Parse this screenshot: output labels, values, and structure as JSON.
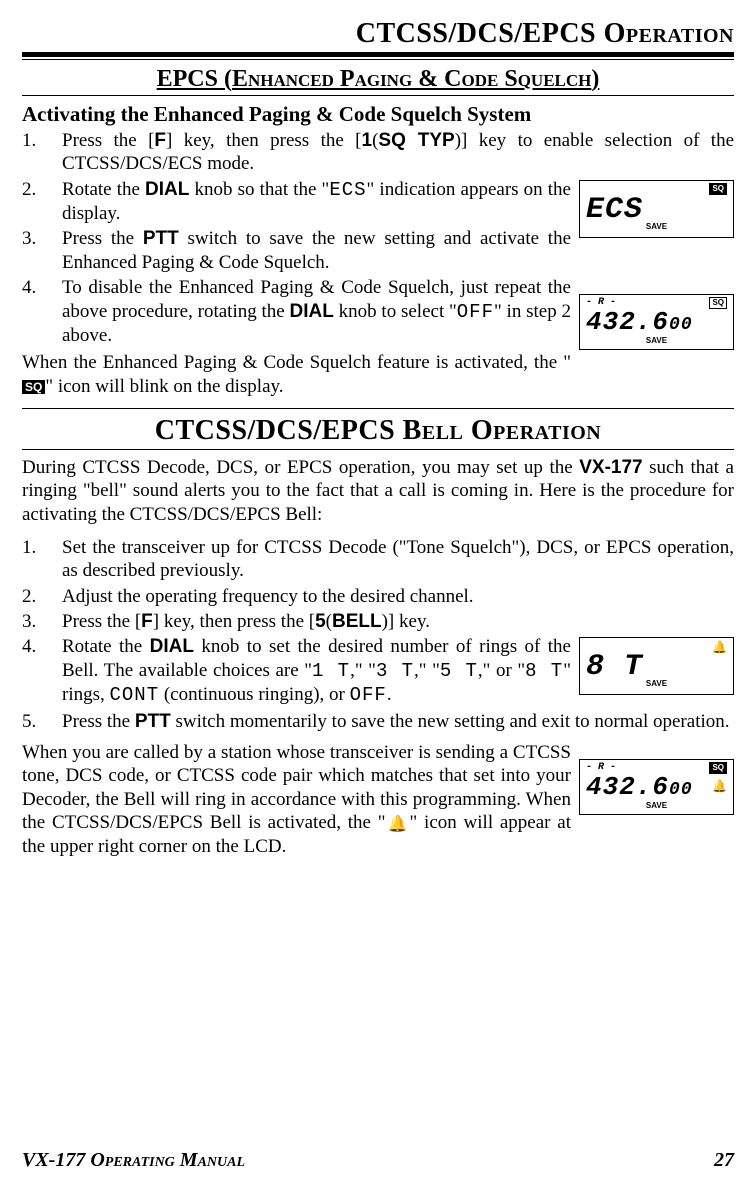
{
  "page_title": "CTCSS/DCS/EPCS Operation",
  "epcs_title_open": "EPCS (",
  "epcs_title_mid": "Enhanced Paging & Code Squelch",
  "epcs_title_close": ")",
  "h3_activating": "Activating the Enhanced Paging & Code Squelch System",
  "steps1": {
    "s1a": "Press the [",
    "s1b": "F",
    "s1c": "] key, then press the [",
    "s1d": "1",
    "s1e": "(",
    "s1f": "SQ TYP",
    "s1g": ")] key to enable selection of the CTCSS/DCS/ECS mode.",
    "s2a": "Rotate the ",
    "s2b": "DIAL",
    "s2c": " knob so that the \"",
    "s2d": "ECS",
    "s2e": "\" indication appears on the display.",
    "s3a": "Press the ",
    "s3b": "PTT",
    "s3c": " switch to save the new setting and activate the Enhanced Paging & Code Squelch.",
    "s4a": "To disable the Enhanced Paging & Code Squelch, just repeat the above procedure, rotating the ",
    "s4b": "DIAL",
    "s4c": " knob to select \"",
    "s4d": "OFF",
    "s4e": "\" in step 2 above."
  },
  "para_blink_a": "When the Enhanced Paging & Code Squelch feature is activated, the \"",
  "para_blink_b": "\" icon will blink on the display.",
  "bell_title": "CTCSS/DCS/EPCS Bell Operation",
  "para_bell_intro_a": "During CTCSS Decode, DCS, or EPCS operation, you may set up the ",
  "para_bell_intro_b": "VX-177",
  "para_bell_intro_c": " such that a ringing \"bell\" sound alerts you to the fact that a call is coming in. Here is the procedure for activating the CTCSS/DCS/EPCS Bell:",
  "steps2": {
    "s1": "Set the transceiver up for CTCSS Decode (\"Tone Squelch\"), DCS, or EPCS operation, as described previously.",
    "s2": "Adjust the operating frequency to the desired channel.",
    "s3a": "Press the [",
    "s3b": "F",
    "s3c": "] key, then press the [",
    "s3d": "5",
    "s3e": "(",
    "s3f": "BELL",
    "s3g": ")] key.",
    "s4a": "Rotate the ",
    "s4b": "DIAL",
    "s4c": " knob to set the desired number of rings of the Bell. The available choices are \"",
    "s4d": "1 T",
    "s4e": ",\" \"",
    "s4f": "3 T",
    "s4g": ",\" \"",
    "s4h": "5 T",
    "s4i": ",\" or \"",
    "s4j": "8 T",
    "s4k": "\" rings, ",
    "s4l": "CONT",
    "s4m": " (continuous ringing), or ",
    "s4n": "OFF",
    "s4o": ".",
    "s5a": "Press the ",
    "s5b": "PTT",
    "s5c": " switch momentarily to save the new setting and exit to normal operation."
  },
  "para_last_a": "When you are called by a station whose transceiver is sending a CTCSS tone, DCS code, or CTCSS code pair which matches that set into your Decoder, the Bell will ring in accordance with this programming. When the CTCSS/DCS/EPCS Bell is activated, the \"",
  "para_last_b": "\" icon will appear at the upper right corner on the LCD.",
  "lcd1": {
    "top_left": "",
    "sq": "SQ",
    "main": "ECS",
    "save": "SAVE"
  },
  "lcd2": {
    "top_left": "- R -",
    "sq": "SQ",
    "main_a": "432.6",
    "main_b": "00",
    "save": "SAVE"
  },
  "lcd3": {
    "main": "8   T",
    "save": "SAVE"
  },
  "lcd4": {
    "top_left": "- R -",
    "sq": "SQ",
    "main_a": "432.6",
    "main_b": "00",
    "save": "SAVE"
  },
  "sq_label": "SQ",
  "bell_glyph": "🔔",
  "footer_left": "VX-177 Operating Manual",
  "footer_right": "27"
}
